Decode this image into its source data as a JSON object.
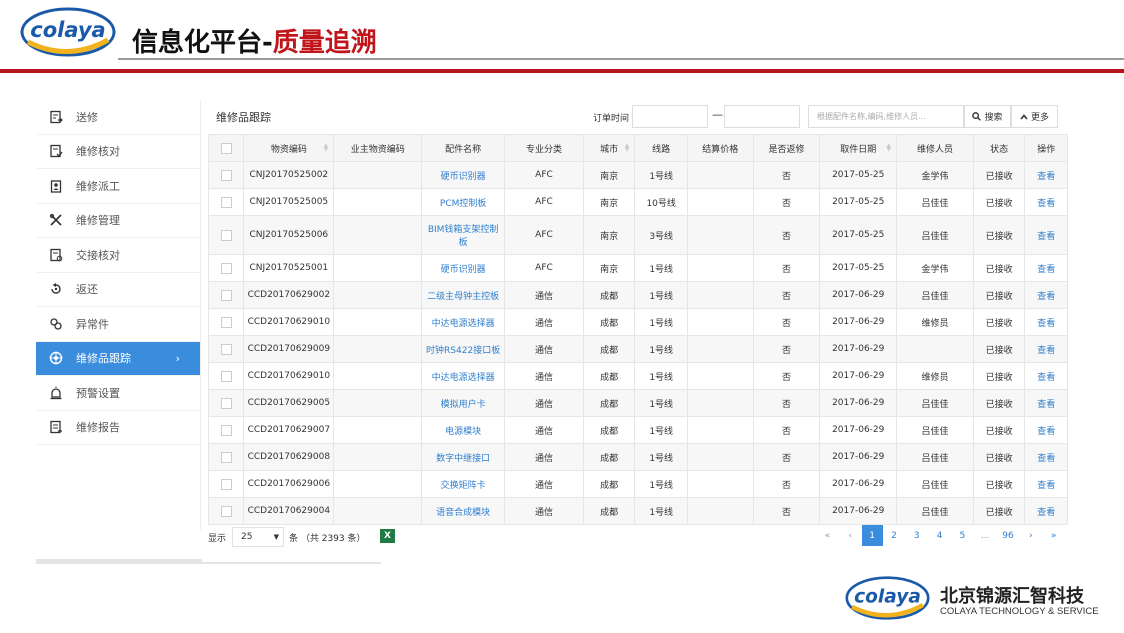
{
  "brand": {
    "logo_text": "colaya",
    "company_cn": "北京锦源汇智科技",
    "company_en": "COLAYA TECHNOLOGY & SERVICE",
    "colors": {
      "logo_blue": "#1a5aa8",
      "logo_yellow": "#f2b21b",
      "title_red": "#c0161b",
      "accent": "#3a8ddc",
      "link": "#2f7fcf"
    }
  },
  "slide": {
    "title_main": "信息化平台-",
    "title_highlight": "质量追溯"
  },
  "sidebar": {
    "items": [
      {
        "label": "送修",
        "icon": "send-repair-icon"
      },
      {
        "label": "维修核对",
        "icon": "repair-check-icon"
      },
      {
        "label": "维修派工",
        "icon": "dispatch-icon"
      },
      {
        "label": "维修管理",
        "icon": "tools-icon"
      },
      {
        "label": "交接核对",
        "icon": "handover-icon"
      },
      {
        "label": "返还",
        "icon": "return-icon"
      },
      {
        "label": "异常件",
        "icon": "exception-icon"
      },
      {
        "label": "维修品跟踪",
        "icon": "tracking-icon",
        "active": true,
        "arrow": "›"
      },
      {
        "label": "预警设置",
        "icon": "alarm-icon"
      },
      {
        "label": "维修报告",
        "icon": "report-icon"
      }
    ]
  },
  "panel": {
    "title": "维修品跟踪",
    "date_label": "订单时间",
    "date_dash": "—",
    "search_placeholder": "根据配件名称,编码,维修人员...",
    "search_button": "搜索",
    "more_button": "更多"
  },
  "table": {
    "columns": [
      "物资编码",
      "业主物资编码",
      "配件名称",
      "专业分类",
      "城市",
      "线路",
      "结算价格",
      "是否返修",
      "取件日期",
      "维修人员",
      "状态",
      "操作"
    ],
    "rows": [
      {
        "code": "CNJ20170525002",
        "owner_code": "",
        "part": "硬币识别器",
        "category": "AFC",
        "city": "南京",
        "line": "1号线",
        "price": "",
        "rework": "否",
        "date": "2017-05-25",
        "staff": "金学伟",
        "status": "已接收",
        "action": "查看"
      },
      {
        "code": "CNJ20170525005",
        "owner_code": "",
        "part": "PCM控制板",
        "category": "AFC",
        "city": "南京",
        "line": "10号线",
        "price": "",
        "rework": "否",
        "date": "2017-05-25",
        "staff": "吕佳佳",
        "status": "已接收",
        "action": "查看"
      },
      {
        "code": "CNJ20170525006",
        "owner_code": "",
        "part": "BIM钱箱支架控制板",
        "category": "AFC",
        "city": "南京",
        "line": "3号线",
        "price": "",
        "rework": "否",
        "date": "2017-05-25",
        "staff": "吕佳佳",
        "status": "已接收",
        "action": "查看"
      },
      {
        "code": "CNJ20170525001",
        "owner_code": "",
        "part": "硬币识别器",
        "category": "AFC",
        "city": "南京",
        "line": "1号线",
        "price": "",
        "rework": "否",
        "date": "2017-05-25",
        "staff": "金学伟",
        "status": "已接收",
        "action": "查看"
      },
      {
        "code": "CCD20170629002",
        "owner_code": "",
        "part": "二级主母钟主控板",
        "category": "通信",
        "city": "成都",
        "line": "1号线",
        "price": "",
        "rework": "否",
        "date": "2017-06-29",
        "staff": "吕佳佳",
        "status": "已接收",
        "action": "查看"
      },
      {
        "code": "CCD20170629010",
        "owner_code": "",
        "part": "中达电源选择器",
        "category": "通信",
        "city": "成都",
        "line": "1号线",
        "price": "",
        "rework": "否",
        "date": "2017-06-29",
        "staff": "维修员",
        "status": "已接收",
        "action": "查看"
      },
      {
        "code": "CCD20170629009",
        "owner_code": "",
        "part": "时钟RS422接口板",
        "category": "通信",
        "city": "成都",
        "line": "1号线",
        "price": "",
        "rework": "否",
        "date": "2017-06-29",
        "staff": "",
        "status": "已接收",
        "action": "查看"
      },
      {
        "code": "CCD20170629010",
        "owner_code": "",
        "part": "中达电源选择器",
        "category": "通信",
        "city": "成都",
        "line": "1号线",
        "price": "",
        "rework": "否",
        "date": "2017-06-29",
        "staff": "维修员",
        "status": "已接收",
        "action": "查看"
      },
      {
        "code": "CCD20170629005",
        "owner_code": "",
        "part": "模拟用户卡",
        "category": "通信",
        "city": "成都",
        "line": "1号线",
        "price": "",
        "rework": "否",
        "date": "2017-06-29",
        "staff": "吕佳佳",
        "status": "已接收",
        "action": "查看"
      },
      {
        "code": "CCD20170629007",
        "owner_code": "",
        "part": "电源模块",
        "category": "通信",
        "city": "成都",
        "line": "1号线",
        "price": "",
        "rework": "否",
        "date": "2017-06-29",
        "staff": "吕佳佳",
        "status": "已接收",
        "action": "查看"
      },
      {
        "code": "CCD20170629008",
        "owner_code": "",
        "part": "数字中继接口",
        "category": "通信",
        "city": "成都",
        "line": "1号线",
        "price": "",
        "rework": "否",
        "date": "2017-06-29",
        "staff": "吕佳佳",
        "status": "已接收",
        "action": "查看"
      },
      {
        "code": "CCD20170629006",
        "owner_code": "",
        "part": "交换矩阵卡",
        "category": "通信",
        "city": "成都",
        "line": "1号线",
        "price": "",
        "rework": "否",
        "date": "2017-06-29",
        "staff": "吕佳佳",
        "status": "已接收",
        "action": "查看"
      },
      {
        "code": "CCD20170629004",
        "owner_code": "",
        "part": "语音合成模块",
        "category": "通信",
        "city": "成都",
        "line": "1号线",
        "price": "",
        "rework": "否",
        "date": "2017-06-29",
        "staff": "吕佳佳",
        "status": "已接收",
        "action": "查看"
      }
    ]
  },
  "footer": {
    "show_label": "显示",
    "page_size": "25",
    "total_label": "条 （共 2393 条）",
    "pages": [
      "«",
      "‹",
      "1",
      "2",
      "3",
      "4",
      "5",
      "...",
      "96",
      "›",
      "»"
    ],
    "current_page": "1"
  }
}
